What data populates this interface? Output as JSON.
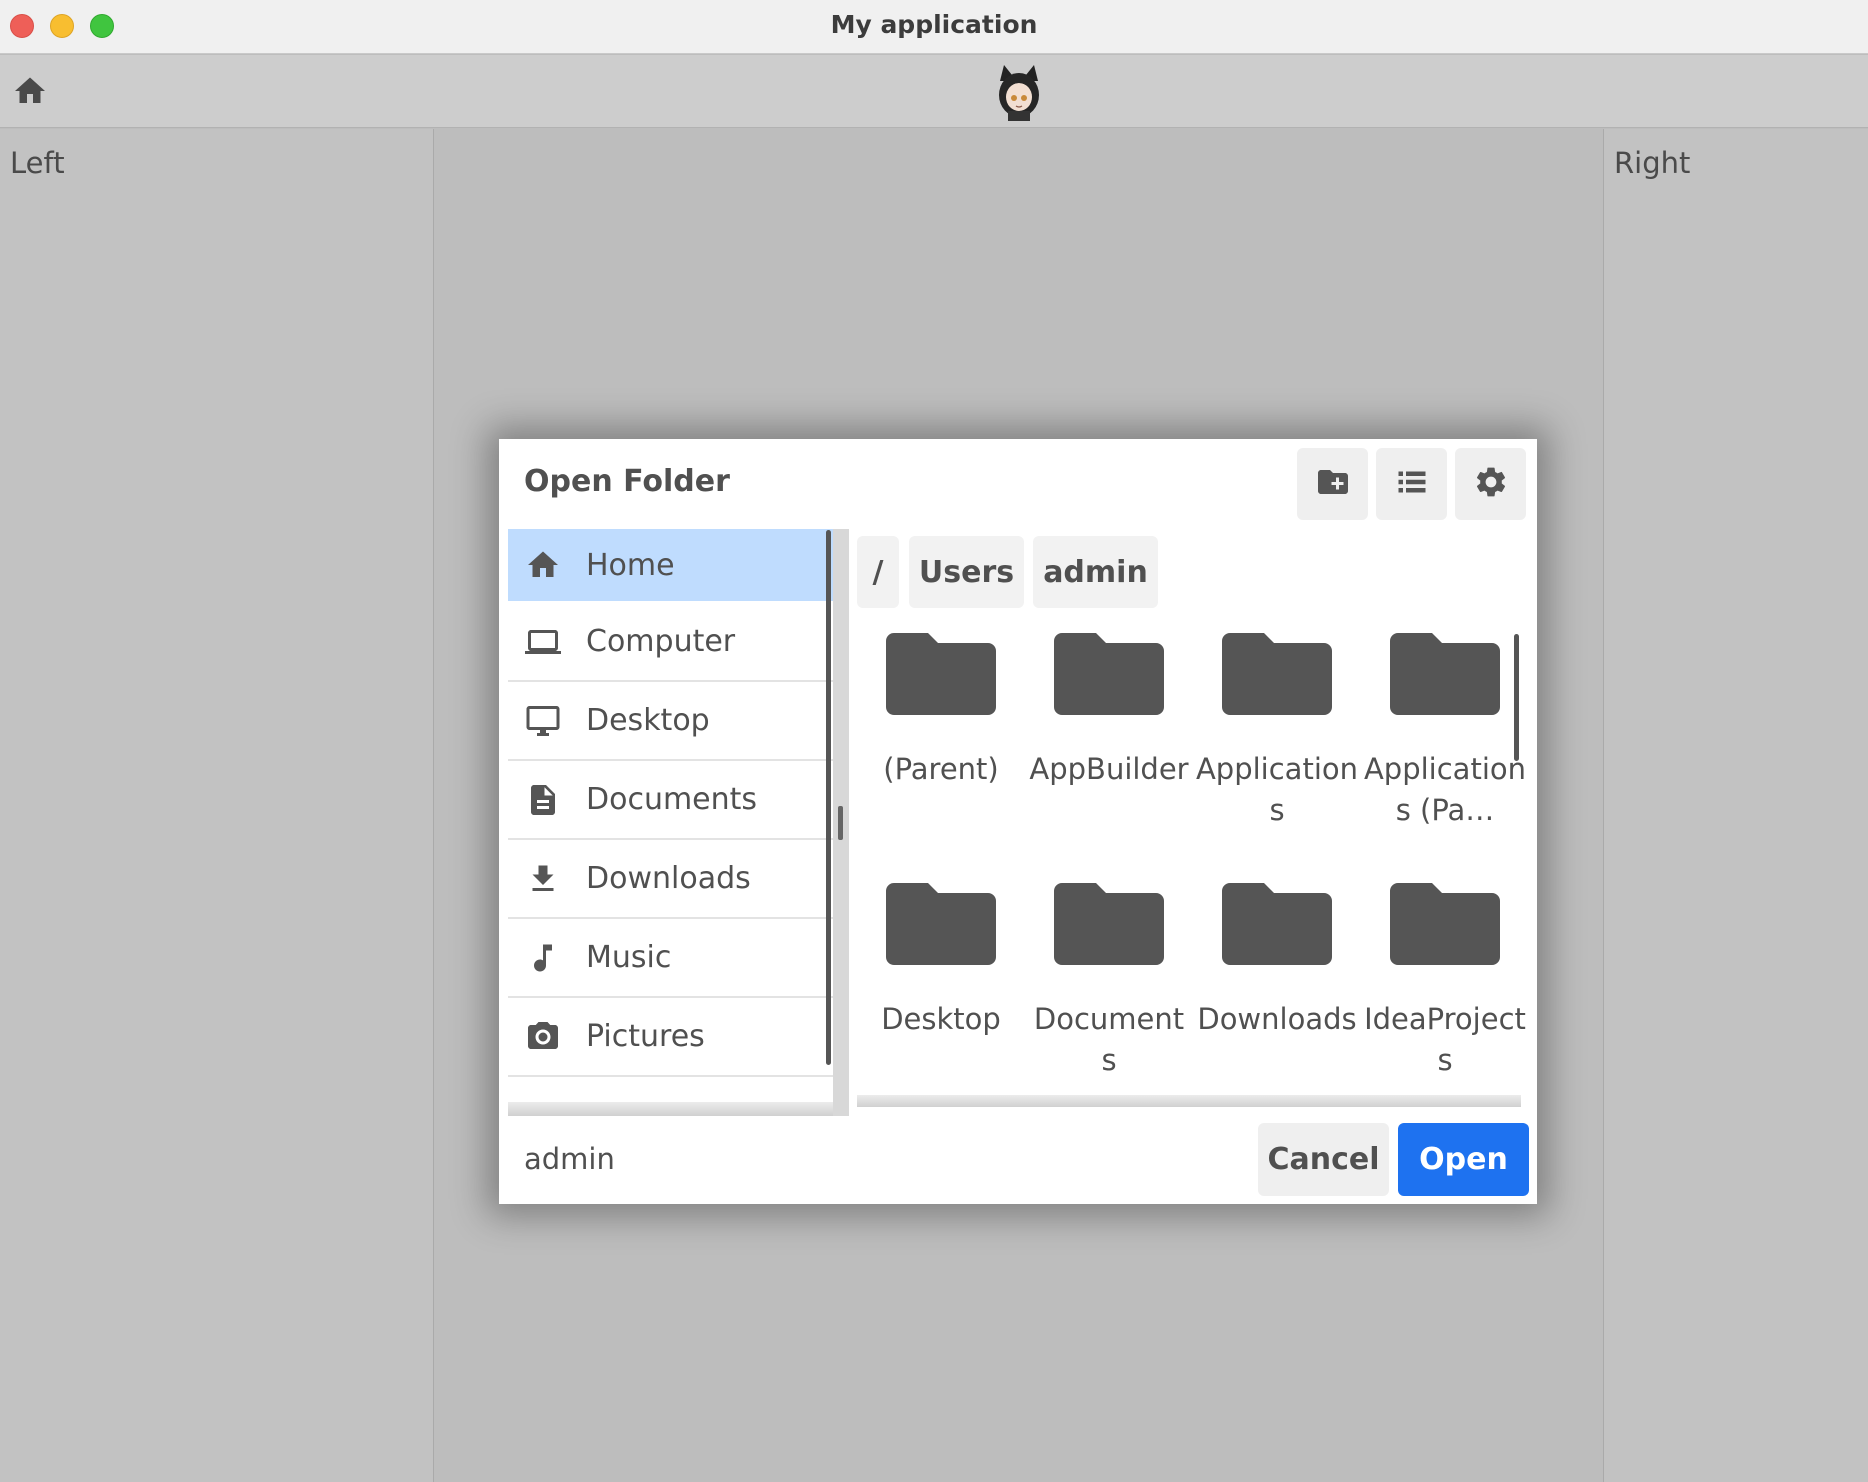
{
  "window": {
    "title": "My application"
  },
  "toolbar": {
    "home_icon": "home-icon",
    "avatar": "anime-avatar"
  },
  "panels": {
    "left_label": "Left",
    "right_label": "Right"
  },
  "dialog": {
    "title": "Open Folder",
    "header_buttons": [
      {
        "name": "new-folder-button",
        "icon": "folder-plus-icon"
      },
      {
        "name": "list-view-button",
        "icon": "list-icon"
      },
      {
        "name": "settings-button",
        "icon": "gear-icon"
      }
    ],
    "sidebar": {
      "items": [
        {
          "label": "Home",
          "icon": "home-icon",
          "selected": true
        },
        {
          "label": "Computer",
          "icon": "laptop-icon"
        },
        {
          "label": "Desktop",
          "icon": "monitor-icon"
        },
        {
          "label": "Documents",
          "icon": "document-icon"
        },
        {
          "label": "Downloads",
          "icon": "download-icon"
        },
        {
          "label": "Music",
          "icon": "music-note-icon"
        },
        {
          "label": "Pictures",
          "icon": "camera-icon"
        }
      ]
    },
    "breadcrumb": [
      "/",
      "Users",
      "admin"
    ],
    "folders": [
      {
        "name": "(Parent)"
      },
      {
        "name": "AppBuilder"
      },
      {
        "name": "Applications"
      },
      {
        "name": "Applications (Pa…"
      },
      {
        "name": "Desktop"
      },
      {
        "name": "Documents"
      },
      {
        "name": "Downloads"
      },
      {
        "name": "IdeaProjects"
      }
    ],
    "footer": {
      "current_name": "admin",
      "cancel_label": "Cancel",
      "open_label": "Open"
    },
    "colors": {
      "selected": "#bfdcfe",
      "primary": "#1e72f0",
      "icon": "#555555"
    }
  }
}
